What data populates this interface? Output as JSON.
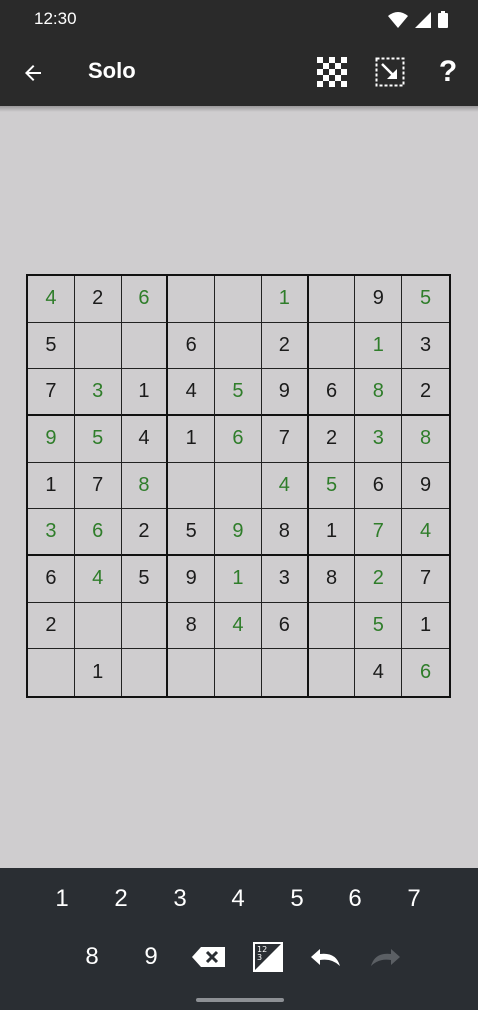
{
  "status_bar": {
    "time": "12:30",
    "icons": [
      "wifi-icon",
      "signal-icon",
      "battery-icon"
    ]
  },
  "app_bar": {
    "title": "Solo",
    "back_icon": "arrow-left-icon",
    "actions": [
      "checkerboard-icon",
      "resize-icon",
      "help-icon"
    ],
    "help_label": "?"
  },
  "board": {
    "given_color": "#1b1b1b",
    "user_color": "#2f7d2a",
    "rows": [
      [
        {
          "v": "4",
          "u": true
        },
        {
          "v": "2",
          "u": false
        },
        {
          "v": "6",
          "u": true
        },
        {
          "v": "",
          "u": false
        },
        {
          "v": "",
          "u": false
        },
        {
          "v": "1",
          "u": true
        },
        {
          "v": "",
          "u": false
        },
        {
          "v": "9",
          "u": false
        },
        {
          "v": "5",
          "u": true
        }
      ],
      [
        {
          "v": "5",
          "u": false
        },
        {
          "v": "",
          "u": false
        },
        {
          "v": "",
          "u": false
        },
        {
          "v": "6",
          "u": false
        },
        {
          "v": "",
          "u": false
        },
        {
          "v": "2",
          "u": false
        },
        {
          "v": "",
          "u": false
        },
        {
          "v": "1",
          "u": true
        },
        {
          "v": "3",
          "u": false
        }
      ],
      [
        {
          "v": "7",
          "u": false
        },
        {
          "v": "3",
          "u": true
        },
        {
          "v": "1",
          "u": false
        },
        {
          "v": "4",
          "u": false
        },
        {
          "v": "5",
          "u": true
        },
        {
          "v": "9",
          "u": false
        },
        {
          "v": "6",
          "u": false
        },
        {
          "v": "8",
          "u": true
        },
        {
          "v": "2",
          "u": false
        }
      ],
      [
        {
          "v": "9",
          "u": true
        },
        {
          "v": "5",
          "u": true
        },
        {
          "v": "4",
          "u": false
        },
        {
          "v": "1",
          "u": false
        },
        {
          "v": "6",
          "u": true
        },
        {
          "v": "7",
          "u": false
        },
        {
          "v": "2",
          "u": false
        },
        {
          "v": "3",
          "u": true
        },
        {
          "v": "8",
          "u": true
        }
      ],
      [
        {
          "v": "1",
          "u": false
        },
        {
          "v": "7",
          "u": false
        },
        {
          "v": "8",
          "u": true
        },
        {
          "v": "",
          "u": false
        },
        {
          "v": "",
          "u": false
        },
        {
          "v": "4",
          "u": true
        },
        {
          "v": "5",
          "u": true
        },
        {
          "v": "6",
          "u": false
        },
        {
          "v": "9",
          "u": false
        }
      ],
      [
        {
          "v": "3",
          "u": true
        },
        {
          "v": "6",
          "u": true
        },
        {
          "v": "2",
          "u": false
        },
        {
          "v": "5",
          "u": false
        },
        {
          "v": "9",
          "u": true
        },
        {
          "v": "8",
          "u": false
        },
        {
          "v": "1",
          "u": false
        },
        {
          "v": "7",
          "u": true
        },
        {
          "v": "4",
          "u": true
        }
      ],
      [
        {
          "v": "6",
          "u": false
        },
        {
          "v": "4",
          "u": true
        },
        {
          "v": "5",
          "u": false
        },
        {
          "v": "9",
          "u": false
        },
        {
          "v": "1",
          "u": true
        },
        {
          "v": "3",
          "u": false
        },
        {
          "v": "8",
          "u": false
        },
        {
          "v": "2",
          "u": true
        },
        {
          "v": "7",
          "u": false
        }
      ],
      [
        {
          "v": "2",
          "u": false
        },
        {
          "v": "",
          "u": false
        },
        {
          "v": "",
          "u": false
        },
        {
          "v": "8",
          "u": false
        },
        {
          "v": "4",
          "u": true
        },
        {
          "v": "6",
          "u": false
        },
        {
          "v": "",
          "u": false
        },
        {
          "v": "5",
          "u": true
        },
        {
          "v": "1",
          "u": false
        }
      ],
      [
        {
          "v": "",
          "u": false
        },
        {
          "v": "1",
          "u": false
        },
        {
          "v": "",
          "u": false
        },
        {
          "v": "",
          "u": false
        },
        {
          "v": "",
          "u": false
        },
        {
          "v": "",
          "u": false
        },
        {
          "v": "",
          "u": false
        },
        {
          "v": "4",
          "u": false
        },
        {
          "v": "6",
          "u": true
        }
      ]
    ]
  },
  "keypad": {
    "digits": [
      "1",
      "2",
      "3",
      "4",
      "5",
      "6",
      "7",
      "8",
      "9"
    ],
    "tools": [
      "backspace-icon",
      "pencil-notes-icon",
      "undo-icon",
      "redo-icon"
    ]
  }
}
